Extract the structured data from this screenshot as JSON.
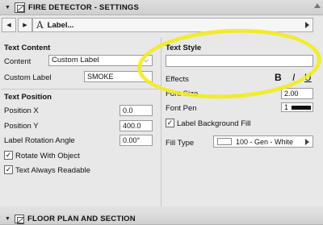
{
  "header": {
    "title": "FIRE DETECTOR - SETTINGS"
  },
  "nav": {
    "label": "Label..."
  },
  "text_content": {
    "title": "Text Content",
    "content_label": "Content",
    "content_value": "Custom Label",
    "custom_label_label": "Custom Label",
    "custom_label_value": "SMOKE"
  },
  "text_position": {
    "title": "Text Position",
    "position_x_label": "Position X",
    "position_x_value": "0.0",
    "position_y_label": "Position Y",
    "position_y_value": "400.0",
    "rotation_label": "Label Rotation Angle",
    "rotation_value": "0.00°",
    "rotate_with_object": "Rotate With Object",
    "always_readable": "Text Always Readable"
  },
  "text_style": {
    "title": "Text Style",
    "style_value": "",
    "effects_label": "Effects",
    "bold": "B",
    "italic": "I",
    "underline": "U",
    "font_size_label": "Font Size",
    "font_size_value": "2.00",
    "font_pen_label": "Font Pen",
    "font_pen_value": "1",
    "bg_fill_label": "Label Background Fill",
    "fill_type_label": "Fill Type",
    "fill_type_value": "100 - Gen - White"
  },
  "footer": {
    "title": "FLOOR PLAN AND SECTION"
  },
  "colors": {
    "highlight": "#f2ec1e",
    "panel": "#e8e8e8"
  }
}
